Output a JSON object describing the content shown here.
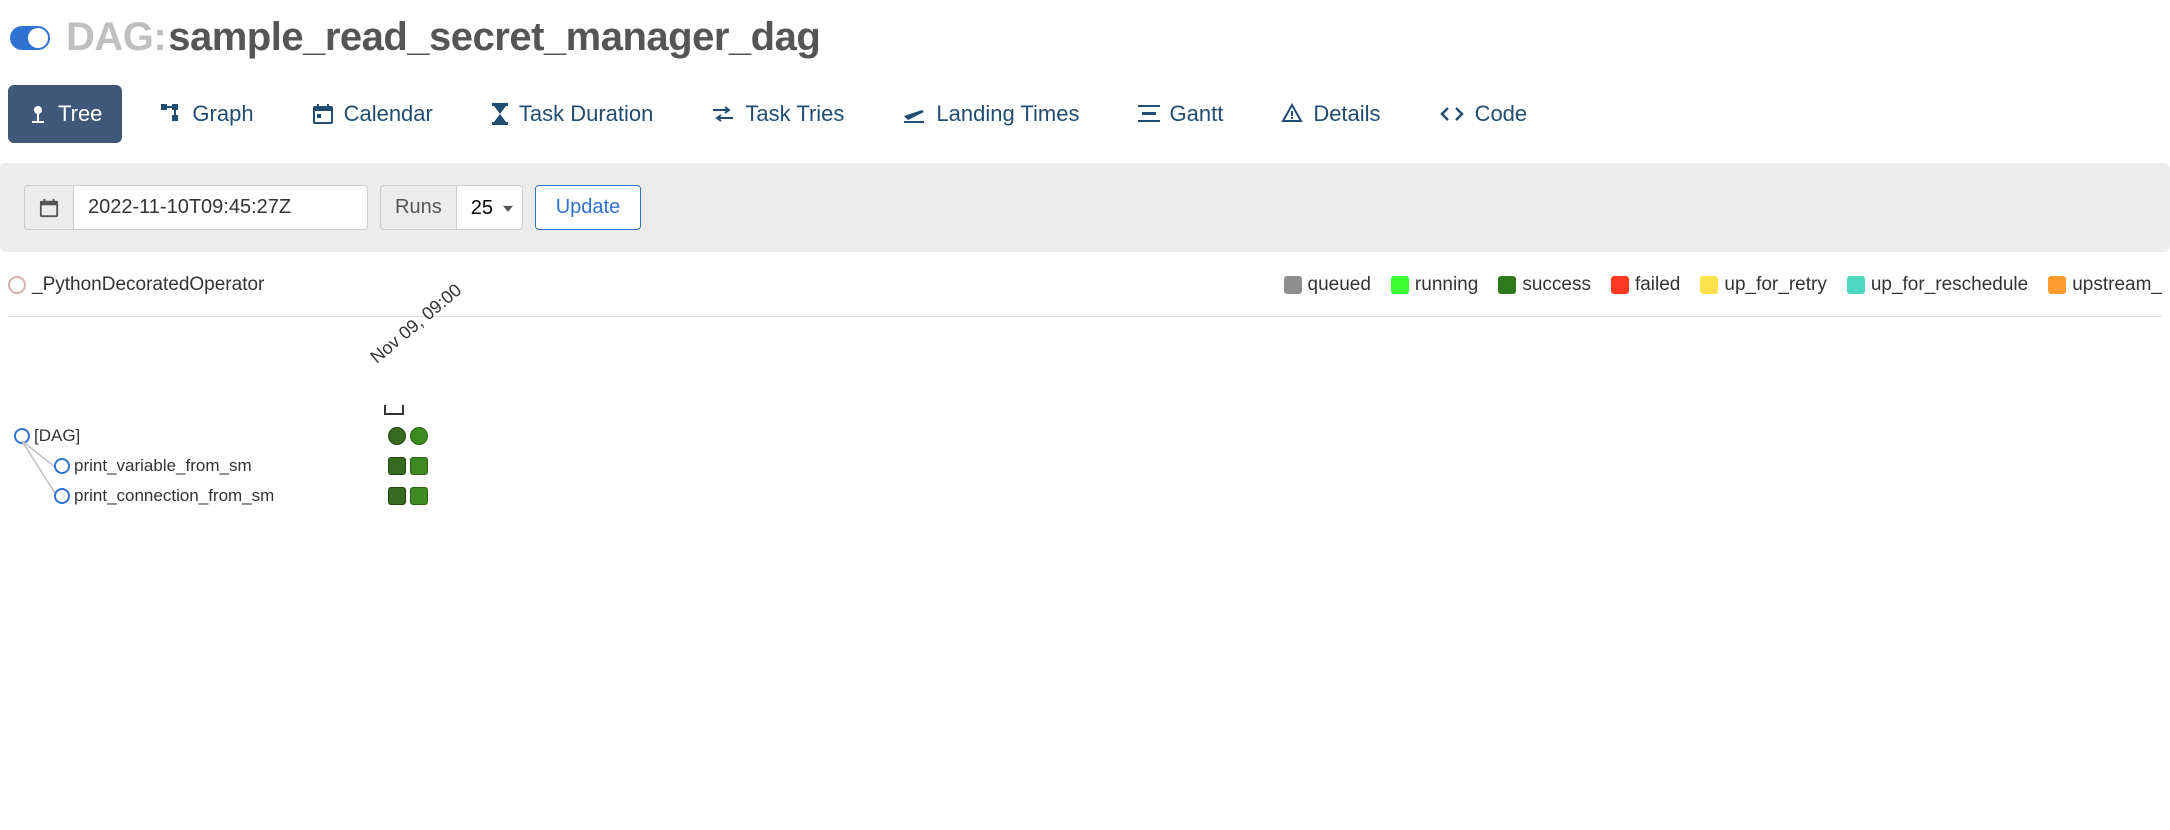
{
  "header": {
    "dag_label": "DAG: ",
    "dag_name": "sample_read_secret_manager_dag"
  },
  "tabs": [
    {
      "label": "Tree",
      "icon": "tree"
    },
    {
      "label": "Graph",
      "icon": "graph"
    },
    {
      "label": "Calendar",
      "icon": "calendar"
    },
    {
      "label": "Task Duration",
      "icon": "hourglass"
    },
    {
      "label": "Task Tries",
      "icon": "retry"
    },
    {
      "label": "Landing Times",
      "icon": "landing"
    },
    {
      "label": "Gantt",
      "icon": "gantt"
    },
    {
      "label": "Details",
      "icon": "details"
    },
    {
      "label": "Code",
      "icon": "code"
    }
  ],
  "controls": {
    "date_value": "2022-11-10T09:45:27Z",
    "runs_label": "Runs",
    "runs_value": "25",
    "update_label": "Update"
  },
  "operator_legend": {
    "label": "_PythonDecoratedOperator"
  },
  "status_legend": [
    {
      "label": "queued",
      "class": "c-queued"
    },
    {
      "label": "running",
      "class": "c-running"
    },
    {
      "label": "success",
      "class": "c-success"
    },
    {
      "label": "failed",
      "class": "c-failed"
    },
    {
      "label": "up_for_retry",
      "class": "c-upforretry"
    },
    {
      "label": "up_for_reschedule",
      "class": "c-upforreschedule"
    },
    {
      "label": "upstream_",
      "class": "c-upstream"
    }
  ],
  "tree": {
    "time_label": "Nov 09, 09:00",
    "rows": [
      {
        "label": "[DAG]",
        "indent": 0,
        "shape": "circle"
      },
      {
        "label": "print_variable_from_sm",
        "indent": 1,
        "shape": "sq"
      },
      {
        "label": "print_connection_from_sm",
        "indent": 1,
        "shape": "sq"
      }
    ]
  }
}
